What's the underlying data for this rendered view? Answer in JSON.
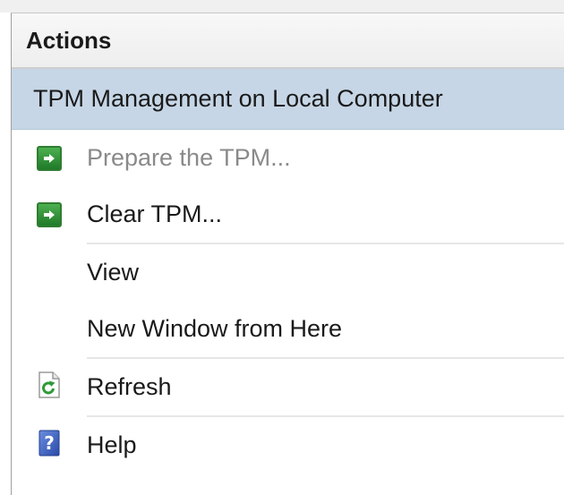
{
  "panel": {
    "title": "Actions",
    "section_title": "TPM Management on Local Computer",
    "items": [
      {
        "label": "Prepare the TPM...",
        "icon": "green-arrow-icon",
        "disabled": true
      },
      {
        "label": "Clear TPM...",
        "icon": "green-arrow-icon",
        "disabled": false
      },
      {
        "label": "View",
        "icon": null,
        "disabled": false
      },
      {
        "label": "New Window from Here",
        "icon": null,
        "disabled": false
      },
      {
        "label": "Refresh",
        "icon": "refresh-icon",
        "disabled": false
      },
      {
        "label": "Help",
        "icon": "help-icon",
        "disabled": false
      }
    ]
  },
  "colors": {
    "section_highlight": "#c6d6e6",
    "action_icon_green": "#2f9a38",
    "disabled_text": "#8a8a8a",
    "help_icon_blue": "#3a5fbf"
  }
}
